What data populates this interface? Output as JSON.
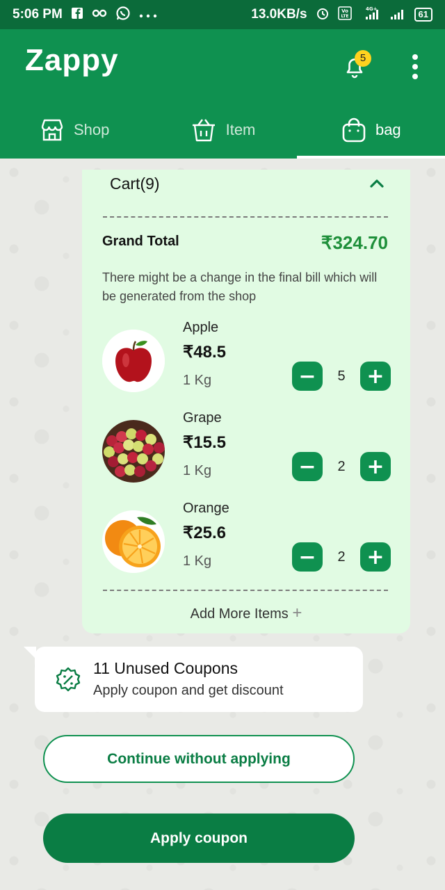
{
  "status_bar": {
    "time": "5:06 PM",
    "speed": "13.0KB/s",
    "network": "4G+",
    "battery": "61"
  },
  "app": {
    "logo": "Zappy",
    "notification_count": "5"
  },
  "tabs": [
    {
      "label": "Shop",
      "icon": "shop-icon"
    },
    {
      "label": "Item",
      "icon": "basket-icon"
    },
    {
      "label": "bag",
      "icon": "bag-icon",
      "active": true
    }
  ],
  "cart": {
    "title": "Cart(9)",
    "grand_total_label": "Grand Total",
    "grand_total_value": "₹324.70",
    "note": "There might be a change in the final bill which will be generated from the shop",
    "items": [
      {
        "name": "Apple",
        "price": "₹48.5",
        "unit": "1 Kg",
        "qty": "5"
      },
      {
        "name": "Grape",
        "price": "₹15.5",
        "unit": "1 Kg",
        "qty": "2"
      },
      {
        "name": "Orange",
        "price": "₹25.6",
        "unit": "1 Kg",
        "qty": "2"
      }
    ],
    "add_more": "Add More Items",
    "add_more_symbol": "+",
    "minus_symbol": "−",
    "plus_symbol": "+"
  },
  "coupon": {
    "title": "11 Unused Coupons",
    "subtitle": "Apply coupon and get discount"
  },
  "buttons": {
    "continue": "Continue without applying",
    "apply": "Apply coupon"
  },
  "colors": {
    "primary": "#0f9150",
    "status_bar": "#0b6b3a",
    "card_bg": "#e1fbe3",
    "price_green": "#1e8f3a"
  }
}
